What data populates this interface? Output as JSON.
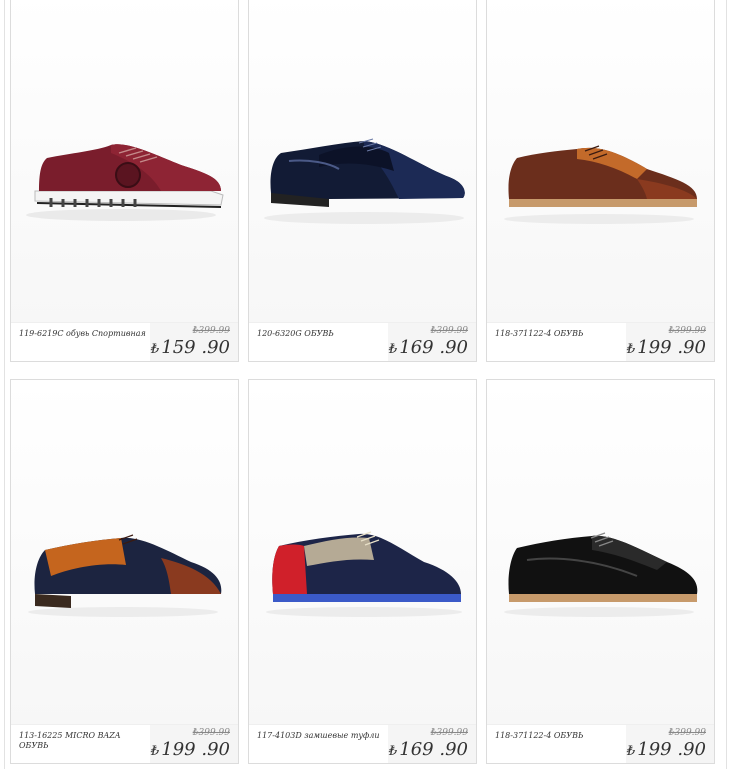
{
  "products": [
    {
      "name": "119-6219C обувь Спортивная",
      "old_price": "₺399.99",
      "currency": "₺",
      "price": "159 .90",
      "image": "red-sneaker"
    },
    {
      "name": "120-6320G ОБУВЬ",
      "old_price": "₺399.99",
      "currency": "₺",
      "price": "169 .90",
      "image": "navy-patent-oxford"
    },
    {
      "name": "118-371122-4 ОБУВЬ",
      "old_price": "₺399.99",
      "currency": "₺",
      "price": "199 .90",
      "image": "brown-wingtip"
    },
    {
      "name": "113-16225 MICRO BAZA ОБУВЬ",
      "old_price": "₺399.99",
      "currency": "₺",
      "price": "199 .90",
      "image": "tan-navy-derby"
    },
    {
      "name": "117-4103D замшевые туфли",
      "old_price": "₺399.99",
      "currency": "₺",
      "price": "169 .90",
      "image": "red-navy-suede-brogue"
    },
    {
      "name": "118-371122-4 ОБУВЬ",
      "old_price": "₺399.99",
      "currency": "₺",
      "price": "199 .90",
      "image": "black-wingtip"
    }
  ]
}
